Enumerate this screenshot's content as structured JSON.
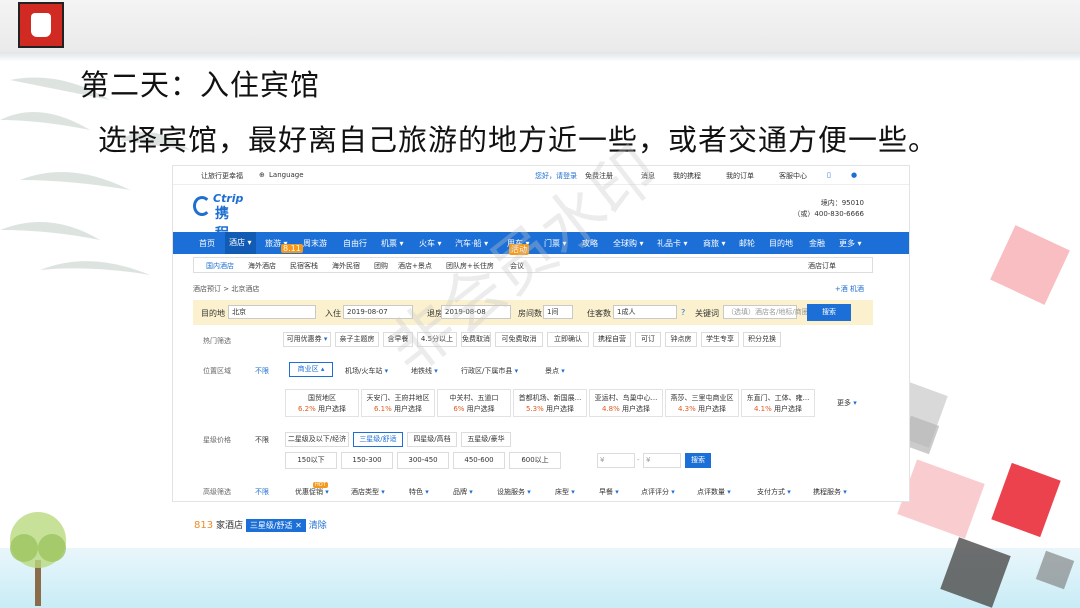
{
  "slide": {
    "title": "第二天：入住宾馆",
    "subtitle": "选择宾馆，最好离自己旅游的地方近一些，或者交通方便一些。",
    "watermark": "非会员水印"
  },
  "topbar": {
    "left": "让旅行更幸福",
    "language": "Language",
    "login": "您好，请登录",
    "register": "免费注册",
    "messages": "消息",
    "my_trip": "我的携程",
    "my_orders": "我的订单",
    "help": "客服中心"
  },
  "brand": {
    "en": "Ctrip",
    "cn": "携程",
    "hotline1": "境内：95010",
    "hotline2": "（或）400-830-6666"
  },
  "nav": {
    "items": [
      "首页",
      "酒店",
      "旅游",
      "周末游",
      "自由行",
      "机票",
      "火车",
      "汽车·船",
      "用车",
      "门票",
      "攻略",
      "全球购",
      "礼品卡",
      "商旅",
      "邮轮",
      "目的地",
      "金融",
      "更多"
    ],
    "badge_travel": "8.11",
    "badge_car": "活动"
  },
  "subnav": {
    "items": [
      "国内酒店",
      "海外酒店",
      "民宿客栈",
      "海外民宿",
      "团购",
      "酒店+景点",
      "团队房+长住房",
      "会议"
    ],
    "right": "酒店订单"
  },
  "breadcrumb": {
    "left": "酒店预订 > 北京酒店",
    "right": "+酒 机酒"
  },
  "search": {
    "dest_label": "目的地",
    "dest_value": "北京",
    "checkin_label": "入住",
    "checkin_value": "2019-08-07",
    "checkout_label": "退房",
    "checkout_value": "2019-08-08",
    "rooms_label": "房间数",
    "rooms_value": "1间",
    "guests_label": "住客数",
    "guests_value": "1成人",
    "keyword_label": "关键词",
    "keyword_placeholder": "（选填）酒店名/地标/商圈",
    "button": "搜索"
  },
  "filters": {
    "hot_label": "热门筛选",
    "hot": [
      "可用优惠券",
      "亲子主题房",
      "含早餐",
      "4.5分以上",
      "免费取消",
      "可免费取消",
      "立即确认",
      "携程自营",
      "可订",
      "钟点房",
      "学生专享",
      "积分兑换"
    ],
    "location_label": "位置区域",
    "unlimited": "不限",
    "location_tabs": [
      "商业区",
      "机场/火车站",
      "地铁线",
      "行政区/下属市县",
      "景点"
    ],
    "areas": [
      {
        "name": "国贸地区",
        "pct": "6.2%",
        "suffix": "用户选择"
      },
      {
        "name": "天安门、王府井地区",
        "pct": "6.1%",
        "suffix": "用户选择"
      },
      {
        "name": "中关村、五道口",
        "pct": "6%",
        "suffix": "用户选择"
      },
      {
        "name": "首都机场、新国展...",
        "pct": "5.3%",
        "suffix": "用户选择"
      },
      {
        "name": "亚运村、鸟巢中心...",
        "pct": "4.8%",
        "suffix": "用户选择"
      },
      {
        "name": "燕莎、三里屯商业区",
        "pct": "4.3%",
        "suffix": "用户选择"
      },
      {
        "name": "东直门、工体、雍...",
        "pct": "4.1%",
        "suffix": "用户选择"
      }
    ],
    "more": "更多",
    "star_label": "星级价格",
    "stars": [
      "二星级及以下/经济",
      "三星级/舒适",
      "四星级/高档",
      "五星级/豪华"
    ],
    "prices": [
      "150以下",
      "150-300",
      "300-450",
      "450-600",
      "600以上"
    ],
    "price_from": "¥",
    "price_to": "¥",
    "price_button": "搜索",
    "advanced_label": "高级筛选",
    "advanced": [
      "优惠促销",
      "酒店类型",
      "特色",
      "品牌",
      "设施服务",
      "床型",
      "早餐",
      "点评评分",
      "点评数量",
      "支付方式",
      "携程服务"
    ],
    "hot_badge": "HOT"
  },
  "results": {
    "count": "813",
    "count_suffix": "家酒店",
    "tag": "三星级/舒适",
    "clear": "清除"
  },
  "colors": {
    "nav_blue": "#1b6fd6",
    "accent_orange": "#f08a24"
  }
}
